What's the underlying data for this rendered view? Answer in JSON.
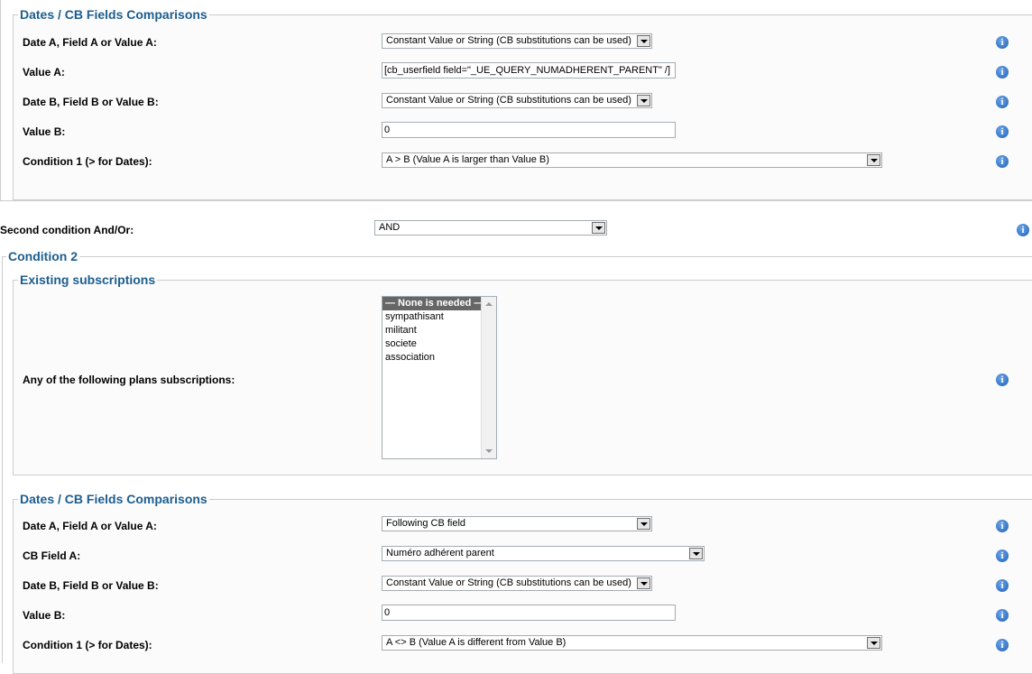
{
  "section1": {
    "legend": "Dates / CB Fields Comparisons",
    "rows": [
      {
        "label": "Date A, Field A or Value A:",
        "value": "Constant Value or String (CB substitutions can be used)"
      },
      {
        "label": "Value A:",
        "value": "[cb_userfield field=\"_UE_QUERY_NUMADHERENT_PARENT\" /]"
      },
      {
        "label": "Date B, Field B or Value B:",
        "value": "Constant Value or String (CB substitutions can be used)"
      },
      {
        "label": "Value B:",
        "value": "0"
      },
      {
        "label": "Condition 1 (> for Dates):",
        "value": "A > B (Value A is larger than Value B)"
      }
    ]
  },
  "second_condition": {
    "label": "Second condition And/Or:",
    "value": "AND"
  },
  "condition2": {
    "legend": "Condition 2",
    "subscriptions": {
      "legend": "Existing subscriptions",
      "label": "Any of the following plans subscriptions:",
      "options": [
        "— None is needed —",
        "sympathisant",
        "militant",
        "societe",
        "association"
      ]
    },
    "comparisons": {
      "legend": "Dates / CB Fields Comparisons",
      "rows": [
        {
          "label": "Date A, Field A or Value A:",
          "value": "Following CB field"
        },
        {
          "label": "CB Field A:",
          "value": "Numéro adhérent parent"
        },
        {
          "label": "Date B, Field B or Value B:",
          "value": "Constant Value or String (CB substitutions can be used)"
        },
        {
          "label": "Value B:",
          "value": "0"
        },
        {
          "label": "Condition 1 (> for Dates):",
          "value": "A <> B (Value A is different from Value B)"
        }
      ]
    }
  },
  "icons": {
    "info": "info-icon",
    "dropdown": "chevron-down-icon"
  },
  "colors": {
    "legend": "#1d5e8f",
    "border": "#cccccc",
    "info": "#1b5fb8"
  }
}
